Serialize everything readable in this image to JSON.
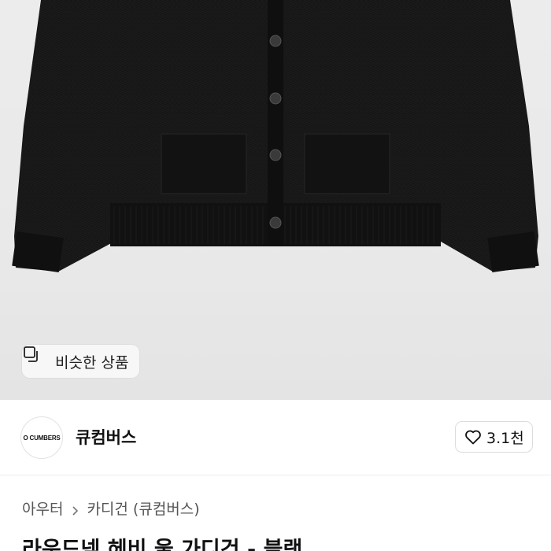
{
  "product": {
    "image_alt": "black knit cardigan",
    "similar_label": "비슷한 상품",
    "title": "라운드넥 헤비 울 가디건 - 블랙"
  },
  "seller": {
    "logo_text": "O CUMBERS",
    "name": "큐컴버스",
    "likes": "3.1천"
  },
  "breadcrumb": {
    "items": [
      "아우터",
      "카디건 (큐컴버스)"
    ]
  },
  "colors": {
    "photo_bg": "#ebebeb",
    "garment": "#141414",
    "chip_bg": "#f7f7f7",
    "text_muted": "#555555"
  },
  "icons": {
    "similar": "similar-products-icon",
    "like": "heart-icon",
    "separator": "chevron-right-icon"
  }
}
